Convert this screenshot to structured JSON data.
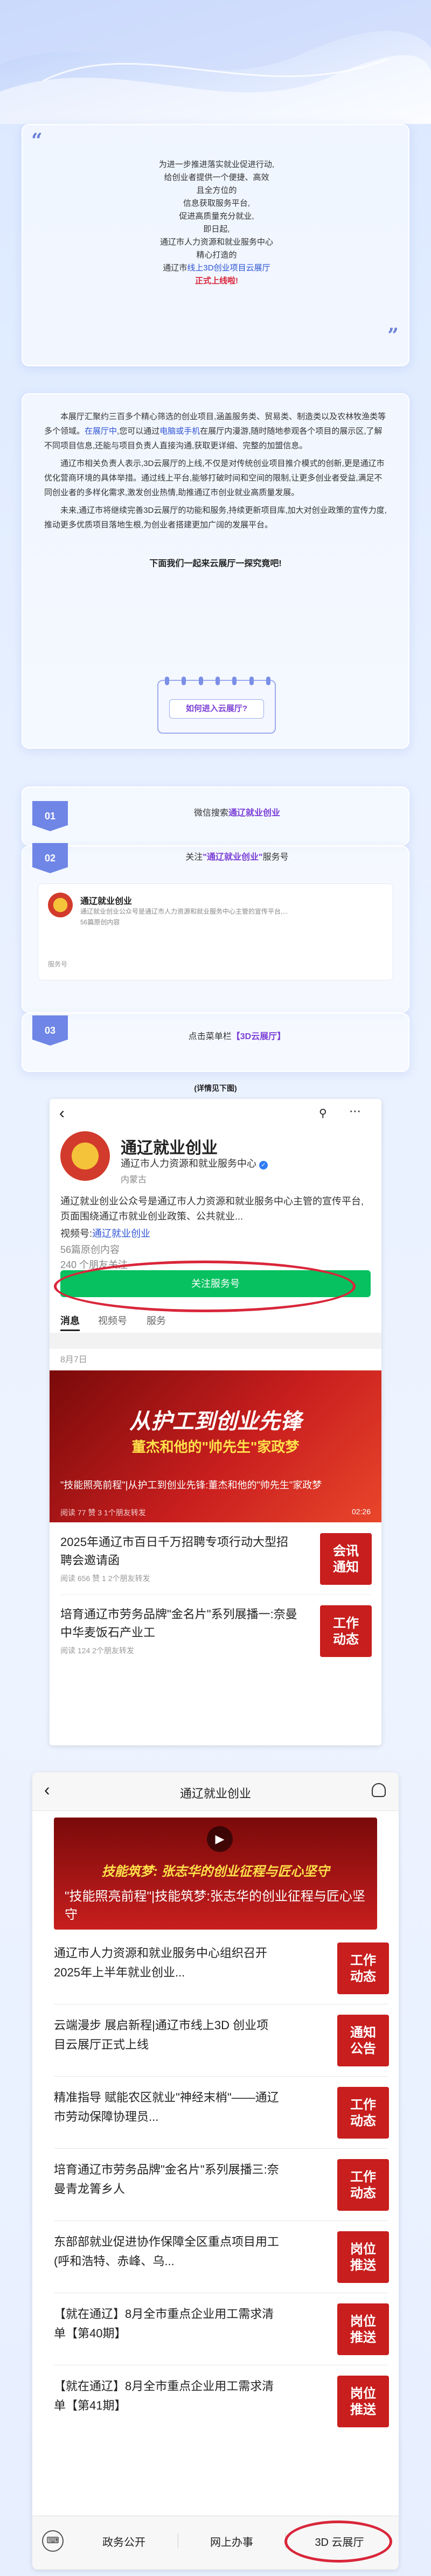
{
  "intro": {
    "lines": [
      "为进一步推进落实就业促进行动,",
      "给创业者提供一个便捷、高效",
      "且全方位的",
      "信息获取服务平台,",
      "促进高质量充分就业,",
      "即日起,",
      "通辽市人力资源和就业服务中心",
      "精心打造的"
    ],
    "highlight_prefix": "通辽市",
    "highlight_main": "线上3D创业项目云展厅",
    "launch": "正式上线啦!"
  },
  "body": {
    "p1_a": "本展厅汇聚约三百多个精心筛选的创业项目,涵盖服务类、贸易类、制造类以及农林牧渔类等多个领域。",
    "p1_b": "在展厅中",
    "p1_c": ",您可以通过",
    "p1_d": "电脑或手机",
    "p1_e": "在展厅内漫游,随时随地参观各个项目的展示区,了解不同项目信息,还能与项目负责人直接沟通,获取更详细、完整的加盟信息。",
    "p2": "通辽市相关负责人表示,3D云展厅的上线,不仅是对传统创业项目推介模式的创新,更是通辽市优化营商环境的具体举措。通过线上平台,能够打破时间和空间的限制,让更多创业者受益,满足不同创业者的多样化需求,激发创业热情,助推通辽市创业就业高质量发展。",
    "p3": "未来,通辽市将继续完善3D云展厅的功能和服务,持续更新项目库,加大对创业政策的宣传力度,推动更多优质项目落地生根,为创业者搭建更加广阔的发展平台。",
    "explore": "下面我们一起来云展厅一探究竟吧!"
  },
  "how_to": {
    "label": "如何进入云展厅?"
  },
  "steps": [
    {
      "num": "01",
      "text_plain": "微信搜索",
      "text_bold": "通辽就业创业",
      "text_after": ""
    },
    {
      "num": "02",
      "text_plain": "关注",
      "text_bold": "\"通辽就业创业\"",
      "text_after": "服务号"
    },
    {
      "num": "03",
      "text_plain": "点击菜单栏",
      "text_bold": "【3D云展厅】",
      "text_after": ""
    }
  ],
  "search_card": {
    "name": "通辽就业创业",
    "desc": "通辽就业创业公众号是通辽市人力资源和就业服务中心主管的宣传平台,...",
    "meta": "56篇原创内容",
    "tag": "服务号"
  },
  "detail_hint": "(详情见下图)",
  "profile": {
    "name": "通辽就业创业",
    "org": "通辽市人力资源和就业服务中心",
    "region": "内蒙古",
    "description": "通辽就业创业公众号是通辽市人力资源和就业服务中心主管的宣传平台,页面围绕通辽市就业创业政策、公共就业...",
    "video_label": "视频号:",
    "video_name": "通辽就业创业",
    "originals": "56篇原创内容",
    "friends": "240 个朋友关注",
    "follow_btn": "关注服务号",
    "tabs": [
      "消息",
      "视频号",
      "服务"
    ],
    "date": "8月7日",
    "banner_line1": "从护工到创业先锋",
    "banner_line2": "董杰和他的\"帅先生\"家政梦",
    "article_title": "\"技能照亮前程\"|从护工到创业先锋:董杰和他的\"帅先生\"家政梦",
    "article_meta": "阅读 77  赞 3  1个朋友转发",
    "duration": "02:26",
    "news": [
      {
        "title": "2025年通辽市百日千万招聘专项行动大型招聘会邀请函",
        "meta": "阅读 656  赞 1  2个朋友转发",
        "thumb": "会讯\n通知"
      },
      {
        "title": "培育通辽市劳务品牌\"金名片\"系列展播一:奈曼中华麦饭石产业工",
        "meta": "阅读 124  2个朋友转发",
        "thumb": "工作\n动态"
      }
    ]
  },
  "menu_view": {
    "title": "通辽就业创业",
    "banner_text": "技能筑梦: 张志华的创业征程与匠心坚守",
    "featured": "\"技能照亮前程\"|技能筑梦:张志华的创业征程与匠心坚守",
    "items": [
      {
        "title": "通辽市人力资源和就业服务中心组织召开2025年上半年就业创业...",
        "thumb": "工作\n动态"
      },
      {
        "title": "云端漫步 展启新程|通辽市线上3D 创业项目云展厅正式上线",
        "thumb": "通知\n公告"
      },
      {
        "title": "精准指导 赋能农区就业\"神经末梢\"——通辽市劳动保障协理员...",
        "thumb": "工作\n动态"
      },
      {
        "title": "培育通辽市劳务品牌\"金名片\"系列展播三:奈曼青龙箐乡人",
        "thumb": "工作\n动态"
      },
      {
        "title": "东部部就业促进协作保障全区重点项目用工(呼和浩特、赤峰、乌...",
        "thumb": "岗位\n推送"
      },
      {
        "title": "【就在通辽】8月全市重点企业用工需求清单【第40期】",
        "thumb": "岗位\n推送"
      },
      {
        "title": "【就在通辽】8月全市重点企业用工需求清单【第41期】",
        "thumb": "岗位\n推送"
      }
    ],
    "bottom_menu": [
      "政务公开",
      "网上办事",
      "3D 云展厅"
    ]
  },
  "colors": {
    "accent": "#6f86e6",
    "brand_green": "#07c160",
    "highlight_red": "#d9263a",
    "link_blue": "#2f55d4",
    "purple": "#7b3fd6"
  }
}
